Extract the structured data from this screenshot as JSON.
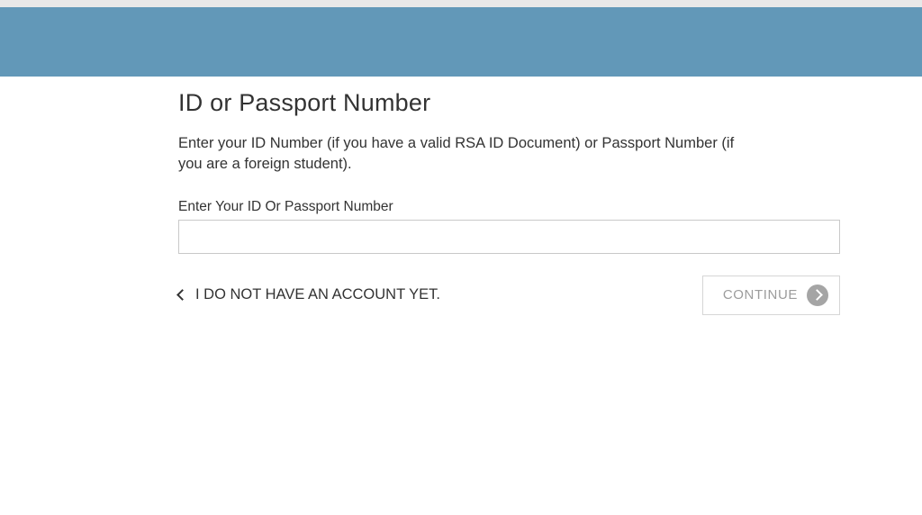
{
  "heading": "ID or Passport Number",
  "instructions": "Enter your ID Number (if you have a valid RSA ID Document) or Passport Number (if you are a foreign student).",
  "input": {
    "label": "Enter Your ID Or Passport Number",
    "value": ""
  },
  "back_link": "I DO NOT HAVE AN ACCOUNT YET.",
  "continue_label": "CONTINUE"
}
